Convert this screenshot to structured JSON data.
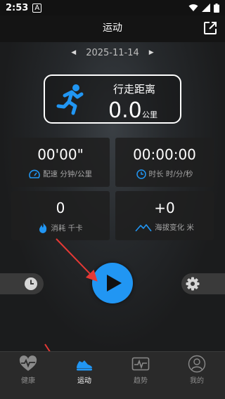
{
  "status": {
    "time": "2:53",
    "a_badge": "A"
  },
  "header": {
    "title": "运动",
    "share_icon": "share-external-icon"
  },
  "date_nav": {
    "date": "2025-11-14",
    "prev_icon": "caret-left-icon",
    "next_icon": "caret-right-icon"
  },
  "distance": {
    "label": "行走距离",
    "value": "0.0",
    "unit": "公里",
    "icon": "running-person-icon",
    "icon_color": "#2196f3"
  },
  "stats": [
    {
      "value": "00'00\"",
      "label": "配速 分钟/公里",
      "icon": "speedometer-icon"
    },
    {
      "value": "00:00:00",
      "label": "时长 时/分/秒",
      "icon": "clock-icon"
    },
    {
      "value": "0",
      "label": "消耗 千卡",
      "icon": "flame-icon"
    },
    {
      "value": "+0",
      "label": "海拔变化 米",
      "icon": "mountain-icon"
    }
  ],
  "controls": {
    "history_icon": "clock-history-icon",
    "play_icon": "play-icon",
    "settings_icon": "gear-icon",
    "accent": "#2196f3"
  },
  "nav": [
    {
      "label": "健康",
      "icon": "heart-pulse-icon",
      "active": false
    },
    {
      "label": "运动",
      "icon": "sneaker-icon",
      "active": true
    },
    {
      "label": "趋势",
      "icon": "trend-chart-icon",
      "active": false
    },
    {
      "label": "我的",
      "icon": "profile-icon",
      "active": false
    }
  ]
}
